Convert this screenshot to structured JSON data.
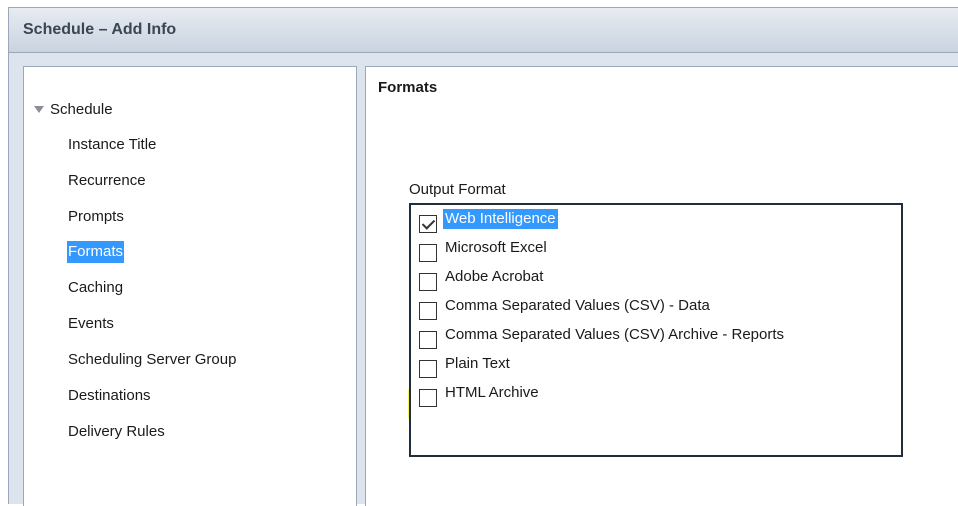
{
  "window": {
    "title": "Schedule – Add Info"
  },
  "nav": {
    "root_label": "Schedule",
    "items": [
      {
        "label": "Instance Title",
        "selected": false
      },
      {
        "label": "Recurrence",
        "selected": false
      },
      {
        "label": "Prompts",
        "selected": false
      },
      {
        "label": "Formats",
        "selected": true
      },
      {
        "label": "Caching",
        "selected": false
      },
      {
        "label": "Events",
        "selected": false
      },
      {
        "label": "Scheduling Server Group",
        "selected": false
      },
      {
        "label": "Destinations",
        "selected": false
      },
      {
        "label": "Delivery Rules",
        "selected": false
      }
    ]
  },
  "content": {
    "section_title": "Formats",
    "output_format": {
      "label": "Output Format",
      "options": [
        {
          "label": "Web Intelligence",
          "checked": true,
          "selected": true
        },
        {
          "label": "Microsoft Excel",
          "checked": false,
          "selected": false
        },
        {
          "label": "Adobe Acrobat",
          "checked": false,
          "selected": false
        },
        {
          "label": "Comma Separated Values (CSV) - Data",
          "checked": false,
          "selected": false
        },
        {
          "label": "Comma Separated Values (CSV) Archive - Reports",
          "checked": false,
          "selected": false
        },
        {
          "label": "Plain Text",
          "checked": false,
          "selected": false
        },
        {
          "label": "HTML Archive",
          "checked": false,
          "selected": false
        }
      ]
    }
  },
  "colors": {
    "selection": "#3399ff",
    "highlight": "#f7f75a",
    "titlebar_text": "#3a4656"
  }
}
